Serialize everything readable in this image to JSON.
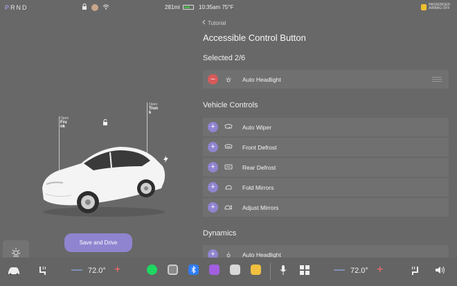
{
  "status_bar": {
    "gear": {
      "p": "P",
      "rest": "RND"
    },
    "range": "281mi",
    "battery_level": 0.6,
    "time_temp": "10:35am 75°F",
    "passenger_airbag": {
      "line1": "PASSENGER",
      "line2": "AIRBAG OFF"
    }
  },
  "car_view": {
    "callout_frunk": {
      "prefix": "Open",
      "name": "Fru",
      "name2": "nk"
    },
    "callout_trunk": {
      "prefix": "Open",
      "name": "Trun",
      "name2": "k"
    },
    "save_button": "Save and Drive"
  },
  "panel": {
    "back_label": "Tutorial",
    "title": "Accessible Control Button",
    "selected_heading": "Selected 2/6",
    "selected_items": [
      {
        "label": "Auto Headlight",
        "icon": "headlight-icon"
      }
    ],
    "vehicle_heading": "Vehicle Controls",
    "vehicle_items": [
      {
        "label": "Auto Wiper",
        "icon": "wiper-icon"
      },
      {
        "label": "Front Defrost",
        "icon": "front-defrost-icon"
      },
      {
        "label": "Rear Defrost",
        "icon": "rear-defrost-icon"
      },
      {
        "label": "Fold Mirrors",
        "icon": "fold-mirror-icon"
      },
      {
        "label": "Adjust Mirrors",
        "icon": "adjust-mirror-icon"
      }
    ],
    "dynamics_heading": "Dynamics",
    "dynamics_items": [
      {
        "label": "Auto Headlight",
        "icon": "headlight-icon"
      }
    ]
  },
  "dock": {
    "left_temp": "72.0°",
    "right_temp": "72.0°",
    "minus": "—",
    "plus": "+"
  },
  "colors": {
    "accent": "#8f84cf",
    "remove": "#d85a5a",
    "background": "#686868"
  }
}
